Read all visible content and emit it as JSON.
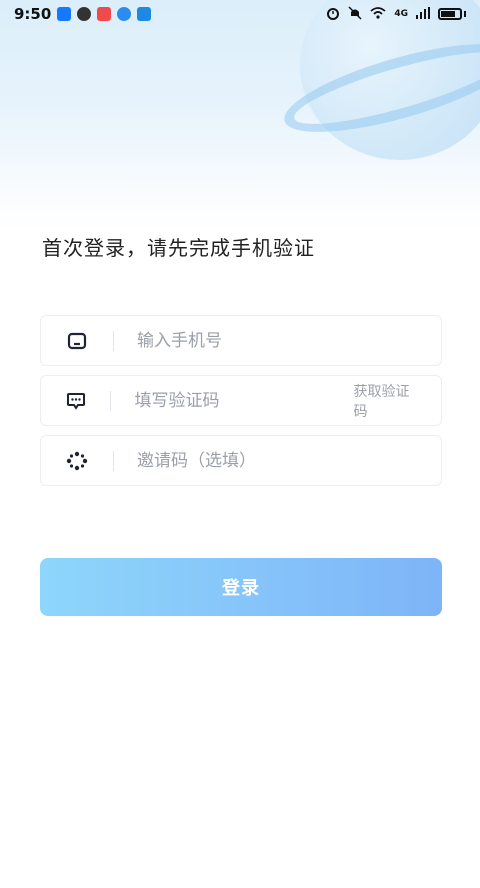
{
  "status_bar": {
    "time": "9:50",
    "network": "4G",
    "notification_icons": [
      "arrow-app-icon",
      "wechat-icon",
      "mail-icon",
      "globe-icon",
      "chat-app-icon"
    ],
    "system_icons": [
      "alarm-icon",
      "mute-icon",
      "wifi-icon",
      "signal-icon",
      "battery-icon"
    ]
  },
  "page": {
    "title": "首次登录，请先完成手机验证"
  },
  "form": {
    "phone": {
      "placeholder": "输入手机号",
      "icon": "phone-icon"
    },
    "code": {
      "placeholder": "填写验证码",
      "icon": "message-icon",
      "get_code_label": "获取验证码"
    },
    "invite": {
      "placeholder": "邀请码（选填）",
      "icon": "invite-icon"
    },
    "submit_label": "登录"
  },
  "colors": {
    "button_gradient_start": "#8ed6fb",
    "button_gradient_end": "#7eb4f8",
    "title_text": "#222222",
    "placeholder_text": "#9a9fa8"
  }
}
